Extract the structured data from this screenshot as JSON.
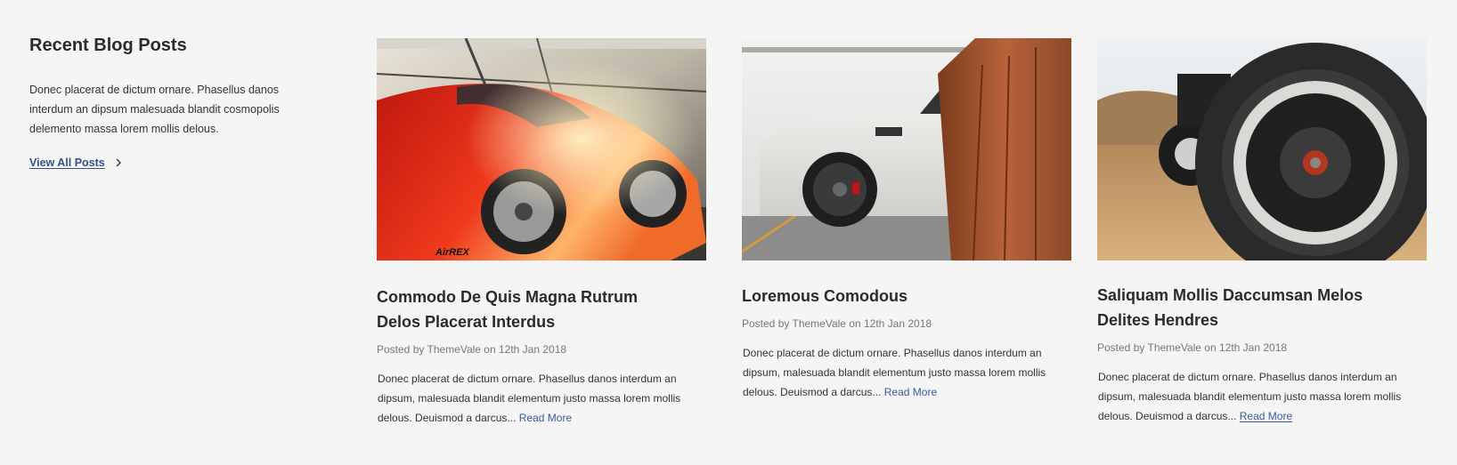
{
  "intro": {
    "title": "Recent Blog Posts",
    "description": "Donec placerat de dictum ornare. Phasellus danos interdum an dipsum malesuada blandit cosmopolis delemento massa lorem mollis delous.",
    "view_all_label": "View All Posts",
    "link_color": "#3a4f8a"
  },
  "posts": [
    {
      "image": "red-sports-car-photo",
      "title_line1": "Commodo De Quis Magna Rutrum",
      "title_line2": "Delos Placerat Interdus",
      "meta": "Posted by ThemeVale on 12th Jan 2018",
      "excerpt": "Donec placerat de dictum ornare. Phasellus danos interdum an dipsum, malesuada blandit elementum justo massa lorem mollis delous. Deuismod a darcus...",
      "read_more": "Read More"
    },
    {
      "image": "white-suv-photo",
      "title_line1": "Loremous Comodous",
      "title_line2": "",
      "meta": "Posted by ThemeVale on 12th Jan 2018",
      "excerpt": "Donec placerat de dictum ornare. Phasellus danos interdum an dipsum, malesuada blandit elementum justo massa lorem mollis delous. Deuismod a darcus...",
      "read_more": "Read More"
    },
    {
      "image": "offroad-tire-photo",
      "title_line1": "Saliquam Mollis Daccumsan Melos",
      "title_line2": "Delites Hendres",
      "meta": "Posted by ThemeVale on 12th Jan 2018",
      "excerpt": "Donec placerat de dictum ornare. Phasellus danos interdum an dipsum, malesuada blandit elementum justo massa lorem mollis delous. Deuismod a darcus...",
      "read_more": "Read More"
    }
  ]
}
